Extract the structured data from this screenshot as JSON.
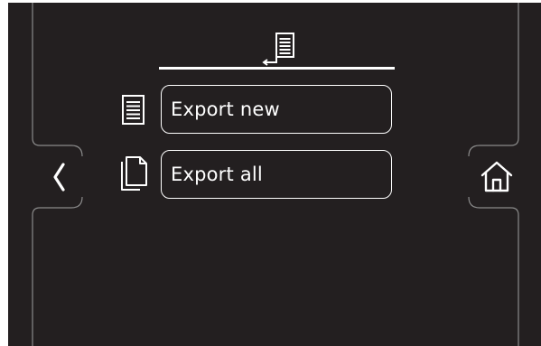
{
  "screen": {
    "background_color": "#231f20",
    "foreground_color": "#ffffff"
  },
  "header": {
    "icon": "export-document-icon"
  },
  "menu": {
    "items": [
      {
        "label": "Export new",
        "icon": "document-lines-icon"
      },
      {
        "label": "Export all",
        "icon": "documents-stack-icon"
      }
    ]
  },
  "nav": {
    "back_icon": "chevron-left-icon",
    "home_icon": "home-icon"
  }
}
